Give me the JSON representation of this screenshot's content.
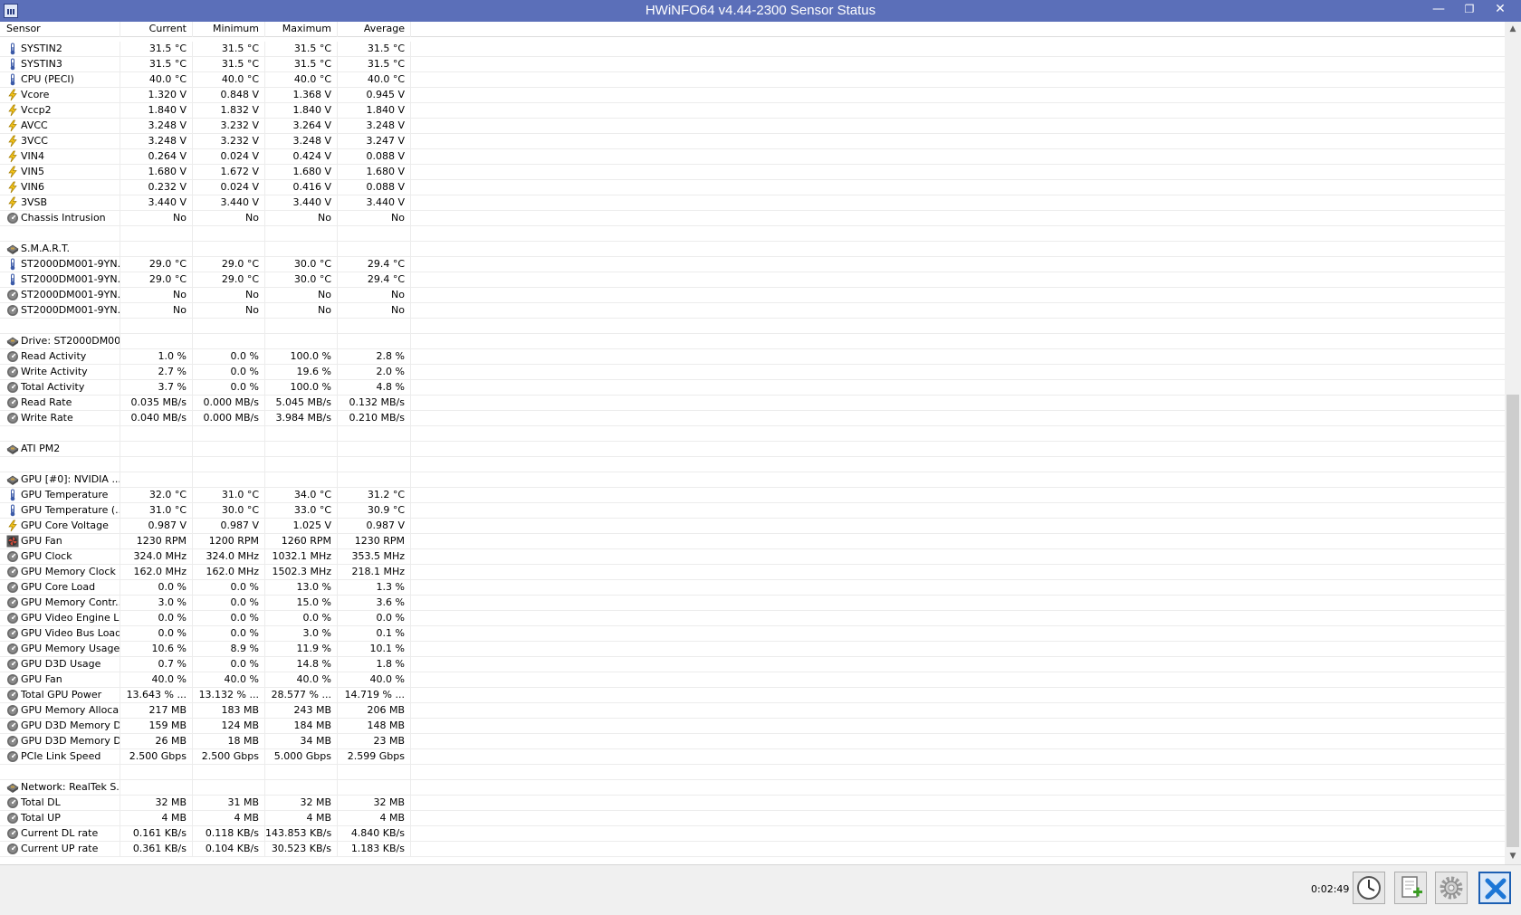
{
  "window": {
    "title": "HWiNFO64 v4.44-2300 Sensor Status",
    "minimize_glyph": "—",
    "maximize_glyph": "❐",
    "close_glyph": "✕"
  },
  "columns": [
    "Sensor",
    "Current",
    "Minimum",
    "Maximum",
    "Average"
  ],
  "rows": [
    {
      "icon": "thermometer-icon",
      "name": "SYSTIN2",
      "current": "31.5 °C",
      "minimum": "31.5 °C",
      "maximum": "31.5 °C",
      "average": "31.5 °C"
    },
    {
      "icon": "thermometer-icon",
      "name": "SYSTIN3",
      "current": "31.5 °C",
      "minimum": "31.5 °C",
      "maximum": "31.5 °C",
      "average": "31.5 °C"
    },
    {
      "icon": "thermometer-icon",
      "name": "CPU (PECI)",
      "current": "40.0 °C",
      "minimum": "40.0 °C",
      "maximum": "40.0 °C",
      "average": "40.0 °C"
    },
    {
      "icon": "voltage-icon",
      "name": "Vcore",
      "current": "1.320 V",
      "minimum": "0.848 V",
      "maximum": "1.368 V",
      "average": "0.945 V"
    },
    {
      "icon": "voltage-icon",
      "name": "Vccp2",
      "current": "1.840 V",
      "minimum": "1.832 V",
      "maximum": "1.840 V",
      "average": "1.840 V"
    },
    {
      "icon": "voltage-icon",
      "name": "AVCC",
      "current": "3.248 V",
      "minimum": "3.232 V",
      "maximum": "3.264 V",
      "average": "3.248 V"
    },
    {
      "icon": "voltage-icon",
      "name": "3VCC",
      "current": "3.248 V",
      "minimum": "3.232 V",
      "maximum": "3.248 V",
      "average": "3.247 V"
    },
    {
      "icon": "voltage-icon",
      "name": "VIN4",
      "current": "0.264 V",
      "minimum": "0.024 V",
      "maximum": "0.424 V",
      "average": "0.088 V"
    },
    {
      "icon": "voltage-icon",
      "name": "VIN5",
      "current": "1.680 V",
      "minimum": "1.672 V",
      "maximum": "1.680 V",
      "average": "1.680 V"
    },
    {
      "icon": "voltage-icon",
      "name": "VIN6",
      "current": "0.232 V",
      "minimum": "0.024 V",
      "maximum": "0.416 V",
      "average": "0.088 V"
    },
    {
      "icon": "voltage-icon",
      "name": "3VSB",
      "current": "3.440 V",
      "minimum": "3.440 V",
      "maximum": "3.440 V",
      "average": "3.440 V"
    },
    {
      "icon": "gauge-icon",
      "name": "Chassis Intrusion",
      "current": "No",
      "minimum": "No",
      "maximum": "No",
      "average": "No"
    },
    {
      "icon": "",
      "name": "",
      "current": "",
      "minimum": "",
      "maximum": "",
      "average": ""
    },
    {
      "icon": "chip-icon",
      "name": "S.M.A.R.T.",
      "current": "",
      "minimum": "",
      "maximum": "",
      "average": "",
      "group": true
    },
    {
      "icon": "thermometer-icon",
      "name": "ST2000DM001-9YN...",
      "current": "29.0 °C",
      "minimum": "29.0 °C",
      "maximum": "30.0 °C",
      "average": "29.4 °C"
    },
    {
      "icon": "thermometer-icon",
      "name": "ST2000DM001-9YN...",
      "current": "29.0 °C",
      "minimum": "29.0 °C",
      "maximum": "30.0 °C",
      "average": "29.4 °C"
    },
    {
      "icon": "gauge-icon",
      "name": "ST2000DM001-9YN...",
      "current": "No",
      "minimum": "No",
      "maximum": "No",
      "average": "No"
    },
    {
      "icon": "gauge-icon",
      "name": "ST2000DM001-9YN...",
      "current": "No",
      "minimum": "No",
      "maximum": "No",
      "average": "No"
    },
    {
      "icon": "",
      "name": "",
      "current": "",
      "minimum": "",
      "maximum": "",
      "average": ""
    },
    {
      "icon": "chip-icon",
      "name": "Drive: ST2000DM00...",
      "current": "",
      "minimum": "",
      "maximum": "",
      "average": "",
      "group": true
    },
    {
      "icon": "gauge-icon",
      "name": "Read Activity",
      "current": "1.0 %",
      "minimum": "0.0 %",
      "maximum": "100.0 %",
      "average": "2.8 %"
    },
    {
      "icon": "gauge-icon",
      "name": "Write Activity",
      "current": "2.7 %",
      "minimum": "0.0 %",
      "maximum": "19.6 %",
      "average": "2.0 %"
    },
    {
      "icon": "gauge-icon",
      "name": "Total Activity",
      "current": "3.7 %",
      "minimum": "0.0 %",
      "maximum": "100.0 %",
      "average": "4.8 %"
    },
    {
      "icon": "gauge-icon",
      "name": "Read Rate",
      "current": "0.035 MB/s",
      "minimum": "0.000 MB/s",
      "maximum": "5.045 MB/s",
      "average": "0.132 MB/s"
    },
    {
      "icon": "gauge-icon",
      "name": "Write Rate",
      "current": "0.040 MB/s",
      "minimum": "0.000 MB/s",
      "maximum": "3.984 MB/s",
      "average": "0.210 MB/s"
    },
    {
      "icon": "",
      "name": "",
      "current": "",
      "minimum": "",
      "maximum": "",
      "average": ""
    },
    {
      "icon": "chip-icon",
      "name": "ATI PM2",
      "current": "",
      "minimum": "",
      "maximum": "",
      "average": "",
      "group": true
    },
    {
      "icon": "",
      "name": "",
      "current": "",
      "minimum": "",
      "maximum": "",
      "average": ""
    },
    {
      "icon": "chip-icon",
      "name": "GPU [#0]: NVIDIA ...",
      "current": "",
      "minimum": "",
      "maximum": "",
      "average": "",
      "group": true
    },
    {
      "icon": "thermometer-icon",
      "name": "GPU Temperature",
      "current": "32.0 °C",
      "minimum": "31.0 °C",
      "maximum": "34.0 °C",
      "average": "31.2 °C"
    },
    {
      "icon": "thermometer-icon",
      "name": "GPU Temperature (...",
      "current": "31.0 °C",
      "minimum": "30.0 °C",
      "maximum": "33.0 °C",
      "average": "30.9 °C"
    },
    {
      "icon": "voltage-icon",
      "name": "GPU Core Voltage",
      "current": "0.987 V",
      "minimum": "0.987 V",
      "maximum": "1.025 V",
      "average": "0.987 V"
    },
    {
      "icon": "fan-icon",
      "name": "GPU Fan",
      "current": "1230 RPM",
      "minimum": "1200 RPM",
      "maximum": "1260 RPM",
      "average": "1230 RPM"
    },
    {
      "icon": "gauge-icon",
      "name": "GPU Clock",
      "current": "324.0 MHz",
      "minimum": "324.0 MHz",
      "maximum": "1032.1 MHz",
      "average": "353.5 MHz"
    },
    {
      "icon": "gauge-icon",
      "name": "GPU Memory Clock",
      "current": "162.0 MHz",
      "minimum": "162.0 MHz",
      "maximum": "1502.3 MHz",
      "average": "218.1 MHz"
    },
    {
      "icon": "gauge-icon",
      "name": "GPU Core Load",
      "current": "0.0 %",
      "minimum": "0.0 %",
      "maximum": "13.0 %",
      "average": "1.3 %"
    },
    {
      "icon": "gauge-icon",
      "name": "GPU Memory Contr...",
      "current": "3.0 %",
      "minimum": "0.0 %",
      "maximum": "15.0 %",
      "average": "3.6 %"
    },
    {
      "icon": "gauge-icon",
      "name": "GPU Video Engine L...",
      "current": "0.0 %",
      "minimum": "0.0 %",
      "maximum": "0.0 %",
      "average": "0.0 %"
    },
    {
      "icon": "gauge-icon",
      "name": "GPU Video Bus Load",
      "current": "0.0 %",
      "minimum": "0.0 %",
      "maximum": "3.0 %",
      "average": "0.1 %"
    },
    {
      "icon": "gauge-icon",
      "name": "GPU Memory Usage",
      "current": "10.6 %",
      "minimum": "8.9 %",
      "maximum": "11.9 %",
      "average": "10.1 %"
    },
    {
      "icon": "gauge-icon",
      "name": "GPU D3D Usage",
      "current": "0.7 %",
      "minimum": "0.0 %",
      "maximum": "14.8 %",
      "average": "1.8 %"
    },
    {
      "icon": "gauge-icon",
      "name": "GPU Fan",
      "current": "40.0 %",
      "minimum": "40.0 %",
      "maximum": "40.0 %",
      "average": "40.0 %"
    },
    {
      "icon": "gauge-icon",
      "name": "Total GPU Power",
      "current": "13.643 % ...",
      "minimum": "13.132 % ...",
      "maximum": "28.577 % ...",
      "average": "14.719 % ..."
    },
    {
      "icon": "gauge-icon",
      "name": "GPU Memory Alloca...",
      "current": "217 MB",
      "minimum": "183 MB",
      "maximum": "243 MB",
      "average": "206 MB"
    },
    {
      "icon": "gauge-icon",
      "name": "GPU D3D Memory D...",
      "current": "159 MB",
      "minimum": "124 MB",
      "maximum": "184 MB",
      "average": "148 MB"
    },
    {
      "icon": "gauge-icon",
      "name": "GPU D3D Memory D...",
      "current": "26 MB",
      "minimum": "18 MB",
      "maximum": "34 MB",
      "average": "23 MB"
    },
    {
      "icon": "gauge-icon",
      "name": "PCIe Link Speed",
      "current": "2.500 Gbps",
      "minimum": "2.500 Gbps",
      "maximum": "5.000 Gbps",
      "average": "2.599 Gbps"
    },
    {
      "icon": "",
      "name": "",
      "current": "",
      "minimum": "",
      "maximum": "",
      "average": ""
    },
    {
      "icon": "chip-icon",
      "name": "Network: RealTek S...",
      "current": "",
      "minimum": "",
      "maximum": "",
      "average": "",
      "group": true
    },
    {
      "icon": "gauge-icon",
      "name": "Total DL",
      "current": "32 MB",
      "minimum": "31 MB",
      "maximum": "32 MB",
      "average": "32 MB"
    },
    {
      "icon": "gauge-icon",
      "name": "Total UP",
      "current": "4 MB",
      "minimum": "4 MB",
      "maximum": "4 MB",
      "average": "4 MB"
    },
    {
      "icon": "gauge-icon",
      "name": "Current DL rate",
      "current": "0.161 KB/s",
      "minimum": "0.118 KB/s",
      "maximum": "143.853 KB/s",
      "average": "4.840 KB/s"
    },
    {
      "icon": "gauge-icon",
      "name": "Current UP rate",
      "current": "0.361 KB/s",
      "minimum": "0.104 KB/s",
      "maximum": "30.523 KB/s",
      "average": "1.183 KB/s"
    }
  ],
  "statusbar": {
    "timer": "0:02:49"
  },
  "colors": {
    "titlebar": "#5b6fb9",
    "exit_button_accent": "#1c5fb3"
  }
}
